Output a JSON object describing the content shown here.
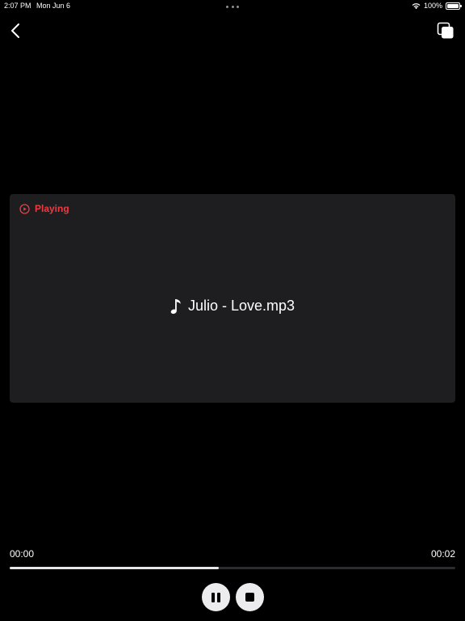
{
  "status_bar": {
    "time": "2:07 PM",
    "date": "Mon Jun 6",
    "battery_percent": "100%",
    "battery_level": 1.0
  },
  "nav": {
    "back_icon": "chevron-left-icon",
    "pip_icon": "picture-in-picture-icon"
  },
  "player": {
    "status_label": "Playing",
    "status_icon": "play-circle-icon",
    "track_icon": "music-note-icon",
    "track_title": "Julio - Love.mp3"
  },
  "timeline": {
    "current_time": "00:00",
    "total_time": "00:02",
    "progress": 0.47
  },
  "controls": {
    "pause_icon": "pause-icon",
    "stop_icon": "stop-icon"
  },
  "colors": {
    "accent": "#f0393f",
    "background": "#000000",
    "card": "#1e1e21",
    "control": "#ececef"
  }
}
